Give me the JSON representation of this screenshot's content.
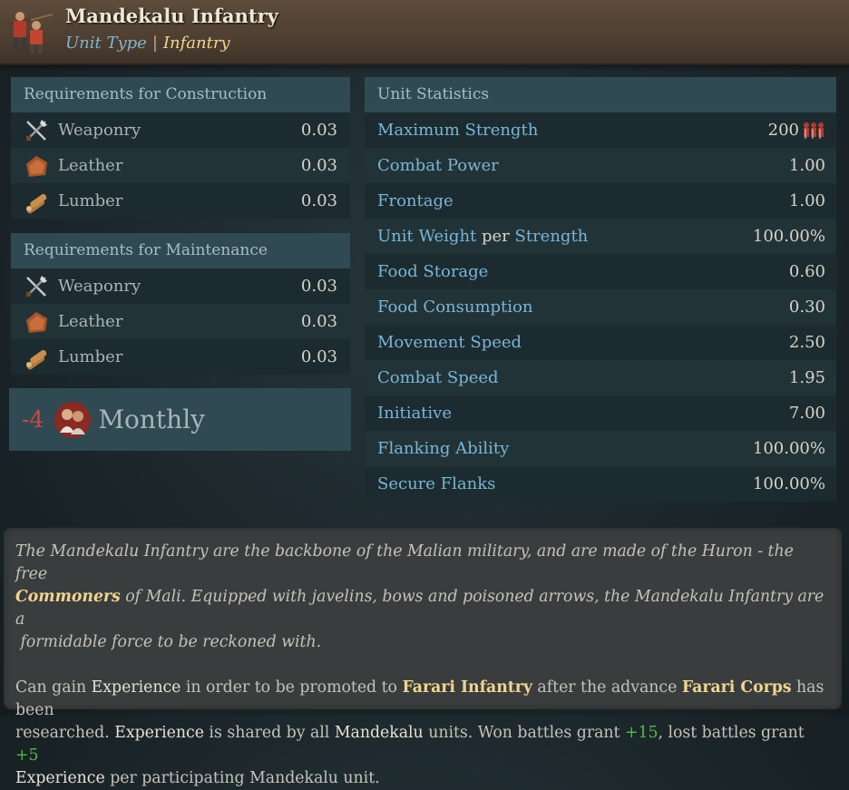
{
  "header": {
    "title": "Mandekalu Infantry",
    "unit_type_label": "Unit Type",
    "separator": "|",
    "unit_type_value": "Infantry"
  },
  "construction": {
    "title": "Requirements for Construction",
    "items": [
      {
        "label": "Weaponry",
        "value": "0.03",
        "icon": "weaponry-icon"
      },
      {
        "label": "Leather",
        "value": "0.03",
        "icon": "leather-icon"
      },
      {
        "label": "Lumber",
        "value": "0.03",
        "icon": "lumber-icon"
      }
    ]
  },
  "maintenance": {
    "title": "Requirements for Maintenance",
    "items": [
      {
        "label": "Weaponry",
        "value": "0.03",
        "icon": "weaponry-icon"
      },
      {
        "label": "Leather",
        "value": "0.03",
        "icon": "leather-icon"
      },
      {
        "label": "Lumber",
        "value": "0.03",
        "icon": "lumber-icon"
      }
    ]
  },
  "monthly": {
    "value": "-4",
    "label": "Monthly",
    "icon": "population-icon"
  },
  "stats": {
    "title": "Unit Statistics",
    "items": [
      {
        "label": "Maximum Strength",
        "value": "200",
        "color": "green",
        "icon": "soldiers-icon"
      },
      {
        "label": "Combat Power",
        "value": "1.00",
        "color": "green"
      },
      {
        "label": "Frontage",
        "value": "1.00",
        "color": "green"
      },
      {
        "label_a": "Unit Weight",
        "label_b": "per",
        "label_c": "Strength",
        "value": "100.00%",
        "color": "red"
      },
      {
        "label": "Food Storage",
        "value": "0.60",
        "color": "green"
      },
      {
        "label": "Food Consumption",
        "value": "0.30",
        "color": "red"
      },
      {
        "label": "Movement Speed",
        "value": "2.50",
        "color": "green"
      },
      {
        "label": "Combat Speed",
        "value": "1.95",
        "color": "green"
      },
      {
        "label": "Initiative",
        "value": "7.00",
        "color": "green"
      },
      {
        "label": "Flanking Ability",
        "value": "100.00%",
        "color": "green"
      },
      {
        "label": "Secure Flanks",
        "value": "100.00%",
        "color": "green"
      }
    ]
  },
  "description": {
    "p1_a": "The Mandekalu Infantry are the backbone of the Malian military, and are made of the Huron - the free",
    "p1_b": "Commoners",
    "p1_c": " of Mali. Equipped with javelins, bows and poisoned arrows, the Mandekalu Infantry are a",
    "p1_d": "formidable force to be reckoned with.",
    "p2_a": "Can gain ",
    "p2_b": "Experience",
    "p2_c": " in order to be promoted to ",
    "p2_d": "Farari Infantry",
    "p2_e": " after the advance ",
    "p2_f": "Farari Corps",
    "p2_g": " has been",
    "p2_h": "researched. ",
    "p2_i": "Experience",
    "p2_j": " is shared by all ",
    "p2_k": "Mandekalu",
    "p2_l": " units. Won battles grant ",
    "p2_m": "+15",
    "p2_n": ", lost battles grant ",
    "p2_o": "+5",
    "p2_p": "Experience",
    "p2_q": " per participating Mandekalu unit."
  },
  "colors": {
    "green": "#4dbc48",
    "red": "#d0473f",
    "label_blue": "#78b6d6",
    "highlight": "#f1d58d"
  }
}
